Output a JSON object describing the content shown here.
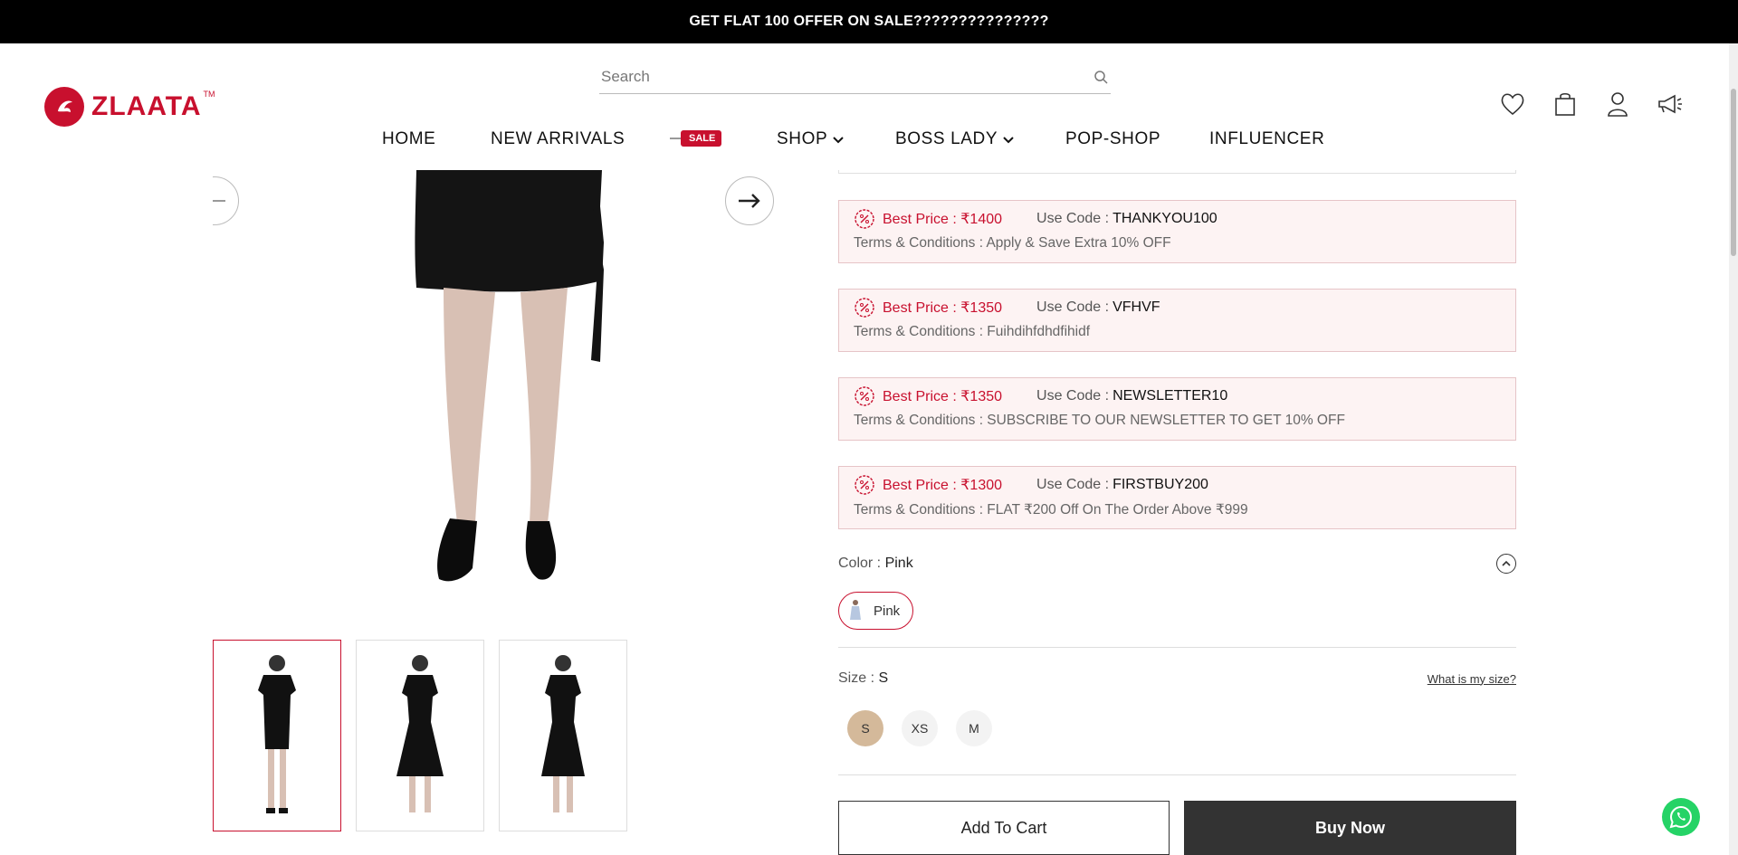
{
  "announcement": "GET FLAT 100 OFFER ON SALE???????????????",
  "brand": {
    "name": "ZLAATA",
    "tm": "TM"
  },
  "search": {
    "placeholder": "Search"
  },
  "nav": {
    "home": "HOME",
    "new_arrivals": "NEW ARRIVALS",
    "sale_tag": "SALE",
    "shop": "SHOP",
    "boss_lady": "BOSS LADY",
    "pop_shop": "POP-SHOP",
    "influencer": "INFLUENCER"
  },
  "coupons": [
    {
      "best_label": "Best Price : ₹1400",
      "code_label": "Use Code :",
      "code": "THANKYOU100",
      "terms": "Terms & Conditions : Apply & Save Extra 10% OFF"
    },
    {
      "best_label": "Best Price : ₹1350",
      "code_label": "Use Code :",
      "code": "VFHVF",
      "terms": "Terms & Conditions : Fuihdihfdhdfihidf"
    },
    {
      "best_label": "Best Price : ₹1350",
      "code_label": "Use Code :",
      "code": "NEWSLETTER10",
      "terms": "Terms & Conditions : SUBSCRIBE TO OUR NEWSLETTER TO GET 10% OFF"
    },
    {
      "best_label": "Best Price : ₹1300",
      "code_label": "Use Code :",
      "code": "FIRSTBUY200",
      "terms": "Terms & Conditions : FLAT ₹200 Off On The Order Above ₹999"
    }
  ],
  "color": {
    "label": "Color :",
    "value": "Pink",
    "swatch_label": "Pink"
  },
  "size": {
    "label": "Size :",
    "value": "S",
    "help_link": "What is my size?",
    "options": [
      "S",
      "XS",
      "M"
    ]
  },
  "buttons": {
    "add_to_cart": "Add To Cart",
    "buy_now": "Buy Now"
  },
  "colors": {
    "accent": "#c8102e",
    "coupon_bg": "#fdf3f3",
    "selected_size": "#d4b99a",
    "whatsapp": "#25d366"
  }
}
